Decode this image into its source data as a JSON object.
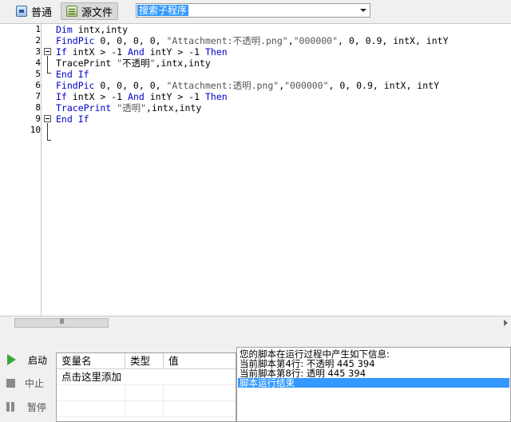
{
  "toolbar": {
    "tab_normal": "普通",
    "tab_source": "源文件",
    "subroutine_combo": "搜索子程序"
  },
  "editor": {
    "line_numbers": [
      "1",
      "2",
      "3",
      "4",
      "5",
      "6",
      "7",
      "8",
      "9",
      "10"
    ],
    "lines": [
      "Dim intx,inty",
      "FindPic 0, 0, 0, 0, \"Attachment:不透明.png\",\"000000\", 0, 0.9, intX, intY",
      "If intX > -1 And intY > -1 Then",
      "TracePrint \"不透明\",intx,inty",
      "End If",
      "FindPic 0, 0, 0, 0, \"Attachment:透明.png\",\"000000\", 0, 0.9, intX, intY",
      "If intX > -1 And intY > -1 Then",
      "TracePrint \"透明\",intx,inty",
      "End If",
      ""
    ]
  },
  "scrollbar": {
    "thumb_grip": "III"
  },
  "controls": {
    "start": "启动",
    "stop": "中止",
    "pause": "暂停"
  },
  "variables": {
    "headers": [
      "变量名",
      "类型",
      "值"
    ],
    "add_row": "点击这里添加"
  },
  "output": {
    "lines": [
      "您的脚本在运行过程中产生如下信息:",
      "当前脚本第4行: 不透明 445 394",
      "当前脚本第8行: 透明 445 394",
      "脚本运行结束"
    ]
  },
  "colors": {
    "keyword": "#0000cc",
    "selection": "#3399ff",
    "start_green": "#3aa63a"
  }
}
